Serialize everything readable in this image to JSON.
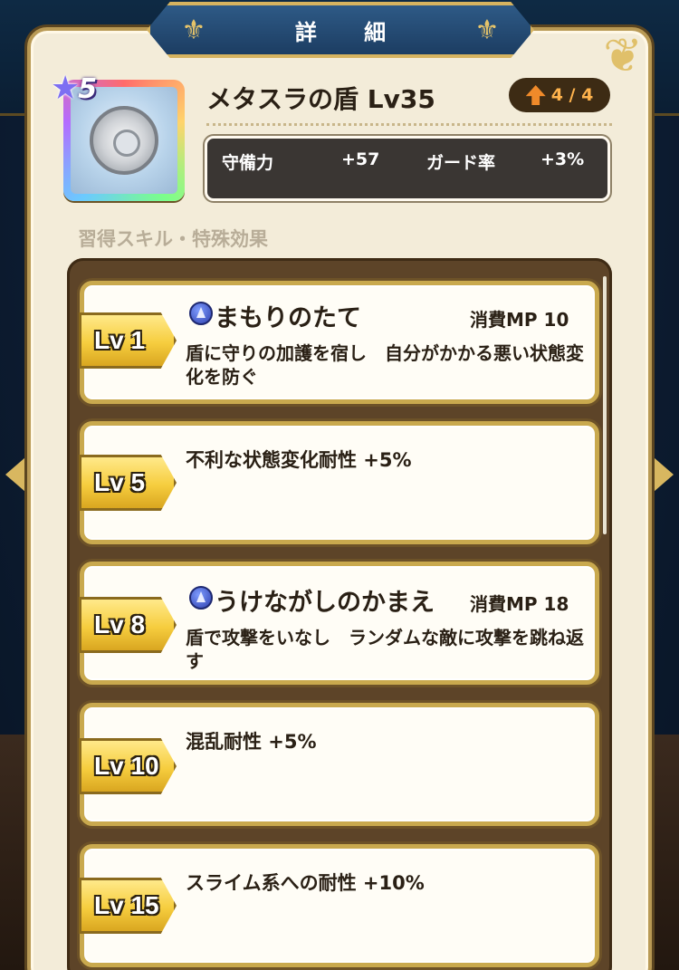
{
  "title": "詳 細",
  "item": {
    "name": "メタスラの盾 Lv35",
    "rarity_stars": "5",
    "icon": "silver-shield-icon",
    "tier": "4 / 4"
  },
  "stats": [
    {
      "label": "守備力",
      "value": "+57"
    },
    {
      "label": "ガード率",
      "value": "+3%"
    }
  ],
  "section_title": "習得スキル・特殊効果",
  "skills": [
    {
      "level": "Lv 1",
      "name": "まもりのたて",
      "mp": "消費MP 10",
      "desc": "盾に守りの加護を宿し　自分がかかる悪い状態変化を防ぐ"
    },
    {
      "level": "Lv 5",
      "effect": "不利な状態変化耐性 +5%"
    },
    {
      "level": "Lv 8",
      "name": "うけながしのかまえ",
      "mp": "消費MP 18",
      "desc": "盾で攻撃をいなし　ランダムな敵に攻撃を跳ね返す"
    },
    {
      "level": "Lv 10",
      "effect": "混乱耐性 +5%"
    },
    {
      "level": "Lv 15",
      "effect": "スライム系への耐性 +10%"
    }
  ],
  "colors": {
    "accent": "#d6b35f",
    "panel": "#f3ecd9",
    "banner": "#1c3d62",
    "tier_text": "#ffb34d"
  }
}
